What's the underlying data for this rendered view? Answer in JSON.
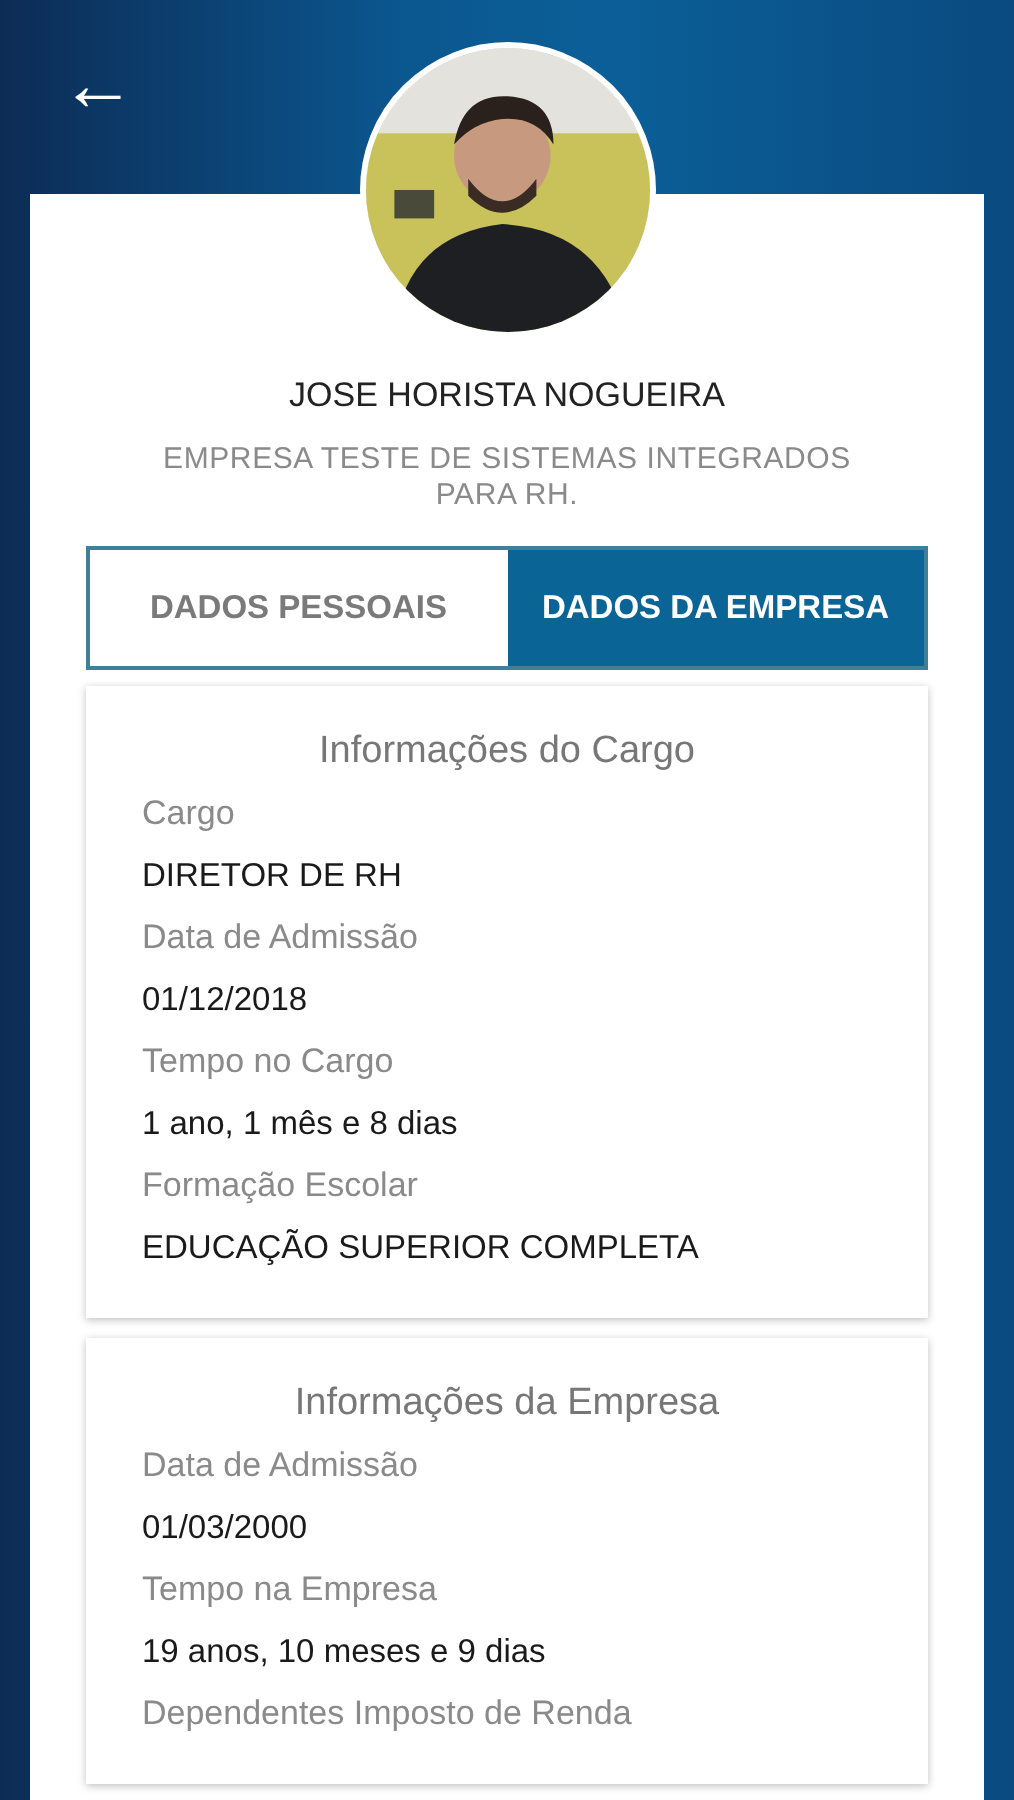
{
  "header": {
    "back": "←"
  },
  "profile": {
    "name": "JOSE HORISTA NOGUEIRA",
    "company": "EMPRESA TESTE DE SISTEMAS INTEGRADOS PARA RH."
  },
  "tabs": [
    {
      "label": "DADOS PESSOAIS",
      "selected": false
    },
    {
      "label": "DADOS DA EMPRESA",
      "selected": true
    }
  ],
  "sections": [
    {
      "title": "Informações do Cargo",
      "fields": [
        {
          "label": "Cargo",
          "value": "DIRETOR DE RH"
        },
        {
          "label": "Data de Admissão",
          "value": "01/12/2018"
        },
        {
          "label": "Tempo no Cargo",
          "value": "1 ano, 1 mês e 8 dias"
        },
        {
          "label": "Formação Escolar",
          "value": "EDUCAÇÃO SUPERIOR COMPLETA"
        }
      ]
    },
    {
      "title": "Informações da Empresa",
      "fields": [
        {
          "label": "Data de Admissão",
          "value": "01/03/2000"
        },
        {
          "label": "Tempo na Empresa",
          "value": "19 anos, 10 meses e 9 dias"
        },
        {
          "label": "Dependentes Imposto de Renda"
        }
      ]
    }
  ]
}
